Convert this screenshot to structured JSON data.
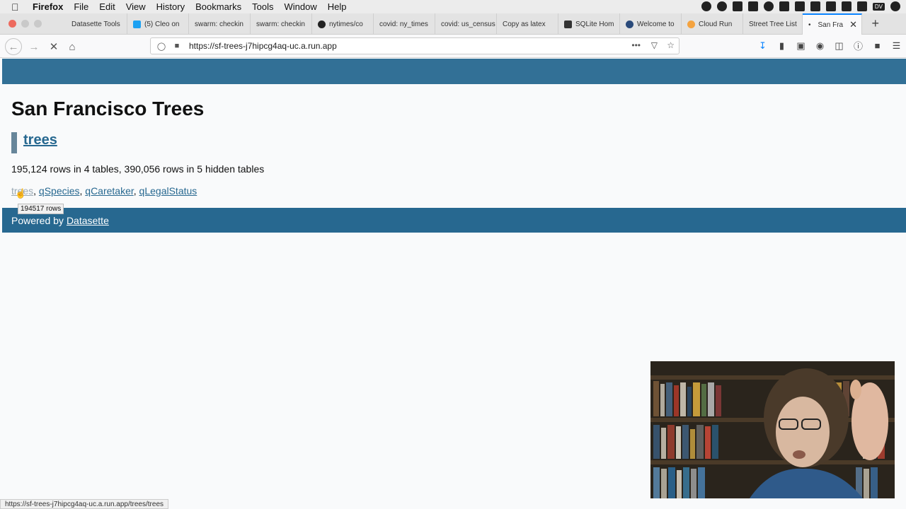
{
  "menubar": {
    "app": "Firefox",
    "items": [
      "File",
      "Edit",
      "View",
      "History",
      "Bookmarks",
      "Tools",
      "Window",
      "Help"
    ],
    "status_badge": "DV"
  },
  "tabs": [
    {
      "label": "Datasette Tools"
    },
    {
      "label": "(5) Cleo on"
    },
    {
      "label": "swarm: checkin"
    },
    {
      "label": "swarm: checkin"
    },
    {
      "label": "nytimes/co"
    },
    {
      "label": "covid: ny_times"
    },
    {
      "label": "covid: us_census"
    },
    {
      "label": "Copy as latex"
    },
    {
      "label": "SQLite Hom"
    },
    {
      "label": "Welcome to"
    },
    {
      "label": "Cloud Run"
    },
    {
      "label": "Street Tree List"
    },
    {
      "label": "San Fra"
    }
  ],
  "navbar": {
    "url": "https://sf-trees-j7hipcg4aq-uc.a.run.app"
  },
  "page": {
    "title": "San Francisco Trees",
    "database": "trees",
    "summary": "195,124 rows in 4 tables, 390,056 rows in 5 hidden tables",
    "tables": [
      "trees",
      "qSpecies",
      "qCaretaker",
      "qLegalStatus"
    ],
    "tooltip": "194517 rows",
    "footer_prefix": "Powered by",
    "footer_link": "Datasette"
  },
  "statusbar": {
    "text": "https://sf-trees-j7hipcg4aq-uc.a.run.app/trees/trees"
  },
  "colors": {
    "header_band": "#276890",
    "link": "#276890",
    "tab_accent": "#0a84ff"
  }
}
